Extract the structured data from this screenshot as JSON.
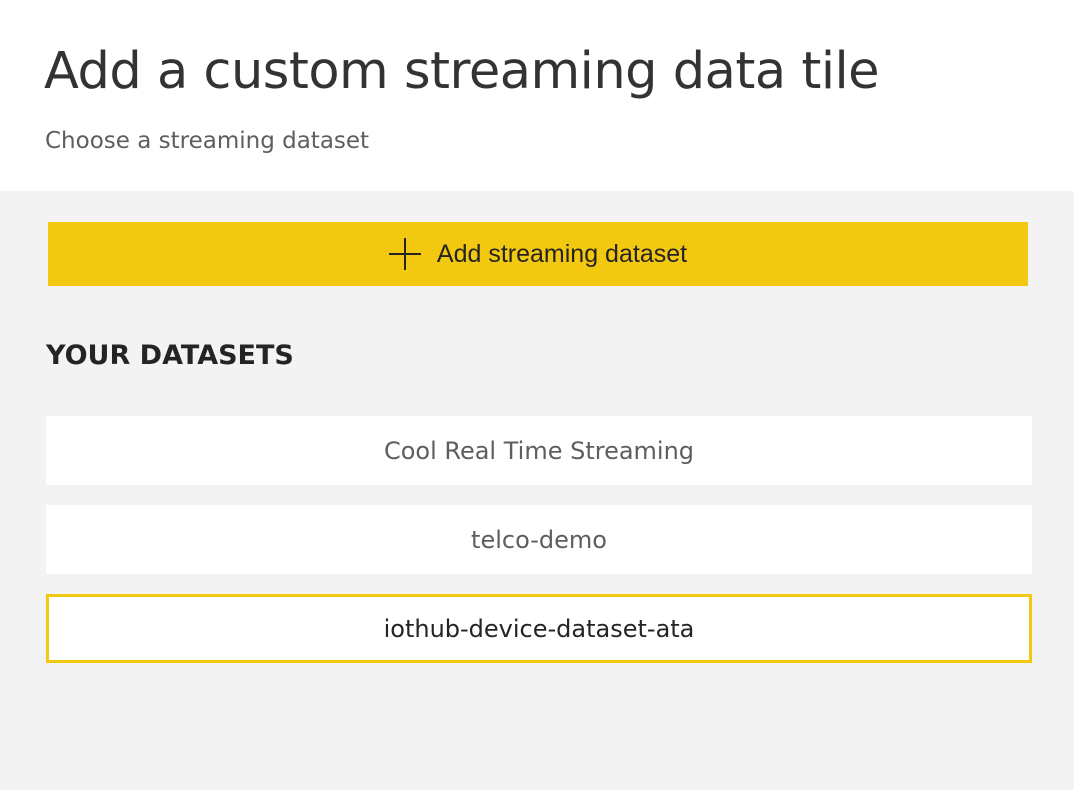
{
  "header": {
    "title": "Add a custom streaming data tile",
    "subtitle": "Choose a streaming dataset"
  },
  "add_button": {
    "icon": "plus-icon",
    "label": "Add streaming dataset",
    "color": "#f2c811"
  },
  "datasets_section": {
    "heading": "YOUR DATASETS",
    "items": [
      {
        "name": "Cool Real Time Streaming",
        "selected": false
      },
      {
        "name": "telco-demo",
        "selected": false
      },
      {
        "name": "iothub-device-dataset-ata",
        "selected": true
      }
    ]
  }
}
